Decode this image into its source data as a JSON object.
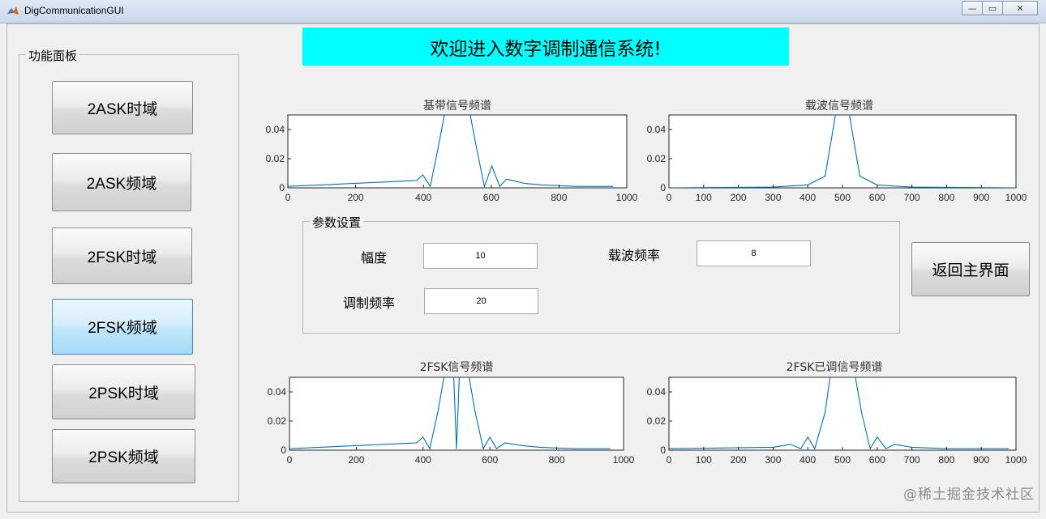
{
  "window": {
    "title": "DigCommunicationGUI",
    "minimize": "—",
    "maximize": "▭",
    "close": "✕"
  },
  "banner": {
    "text": "欢迎进入数字调制通信系统!"
  },
  "side_panel": {
    "title": "功能面板",
    "buttons": [
      {
        "label": "2ASK时域"
      },
      {
        "label": "2ASK频域"
      },
      {
        "label": "2FSK时域"
      },
      {
        "label": "2FSK频域",
        "active": true
      },
      {
        "label": "2PSK时域"
      },
      {
        "label": "2PSK频域"
      }
    ]
  },
  "params": {
    "title": "参数设置",
    "amplitude_label": "幅度",
    "amplitude_value": "10",
    "carrier_freq_label": "载波频率",
    "carrier_freq_value": "8",
    "mod_freq_label": "调制频率",
    "mod_freq_value": "20"
  },
  "return_button": {
    "label": "返回主界面"
  },
  "watermark": "@稀土掘金技术社区",
  "colors": {
    "banner": "#00ffff",
    "line": "#0072bd"
  },
  "chart_data": [
    {
      "type": "line",
      "title": "基带信号频谱",
      "xlim": [
        0,
        1000
      ],
      "ylim": [
        0,
        0.05
      ],
      "xticks": [
        0,
        200,
        400,
        600,
        800,
        1000
      ],
      "yticks": [
        0,
        0.02,
        0.04
      ],
      "ytick_labels": [
        "0",
        "0.02",
        "0.04"
      ],
      "series": [
        {
          "x": [
            0,
            380,
            398,
            420,
            443,
            470,
            500,
            530,
            557,
            580,
            602,
            625,
            645,
            700,
            750,
            800,
            850,
            900,
            960
          ],
          "y": [
            0.001,
            0.005,
            0.009,
            0.001,
            0.027,
            0.06,
            0.06,
            0.06,
            0.027,
            0.001,
            0.015,
            0.001,
            0.006,
            0.003,
            0.002,
            0.0015,
            0.001,
            0.001,
            0.001
          ]
        }
      ]
    },
    {
      "type": "line",
      "title": "载波信号频谱",
      "xlim": [
        0,
        1000
      ],
      "ylim": [
        0,
        0.05
      ],
      "xticks": [
        0,
        100,
        200,
        300,
        400,
        500,
        600,
        700,
        800,
        900,
        1000
      ],
      "yticks": [
        0,
        0.02,
        0.04
      ],
      "ytick_labels": [
        "0",
        "0.02",
        "0.04"
      ],
      "series": [
        {
          "x": [
            0,
            300,
            400,
            450,
            480,
            500,
            520,
            550,
            600,
            700,
            1000
          ],
          "y": [
            0,
            0.0005,
            0.002,
            0.008,
            0.05,
            0.06,
            0.05,
            0.008,
            0.002,
            0.0005,
            0
          ]
        }
      ]
    },
    {
      "type": "line",
      "title": "2FSK信号频谱",
      "xlim": [
        0,
        1000
      ],
      "ylim": [
        0,
        0.05
      ],
      "xticks": [
        0,
        200,
        400,
        600,
        800,
        1000
      ],
      "yticks": [
        0,
        0.02,
        0.04
      ],
      "ytick_labels": [
        "0",
        "0.02",
        "0.04"
      ],
      "series": [
        {
          "x": [
            0,
            380,
            400,
            420,
            445,
            470,
            490,
            500,
            510,
            530,
            555,
            580,
            600,
            620,
            645,
            700,
            750,
            800,
            850,
            960
          ],
          "y": [
            0.001,
            0.005,
            0.009,
            0.001,
            0.027,
            0.06,
            0.06,
            0.001,
            0.06,
            0.06,
            0.027,
            0.001,
            0.009,
            0.001,
            0.005,
            0.003,
            0.002,
            0.0015,
            0.001,
            0.001
          ]
        }
      ]
    },
    {
      "type": "line",
      "title": "2FSK已调信号频谱",
      "xlim": [
        0,
        1000
      ],
      "ylim": [
        0,
        0.05
      ],
      "xticks": [
        0,
        100,
        200,
        300,
        400,
        500,
        600,
        700,
        800,
        900,
        1000
      ],
      "yticks": [
        0,
        0.02,
        0.04
      ],
      "ytick_labels": [
        "0",
        "0.02",
        "0.04"
      ],
      "series": [
        {
          "x": [
            0,
            300,
            350,
            380,
            400,
            420,
            450,
            470,
            500,
            530,
            555,
            580,
            600,
            625,
            650,
            700,
            750,
            800,
            900,
            980
          ],
          "y": [
            0.001,
            0.002,
            0.004,
            0.001,
            0.009,
            0.001,
            0.026,
            0.06,
            0.06,
            0.06,
            0.026,
            0.001,
            0.009,
            0.001,
            0.004,
            0.002,
            0.0015,
            0.001,
            0.001,
            0.001
          ]
        }
      ]
    }
  ]
}
